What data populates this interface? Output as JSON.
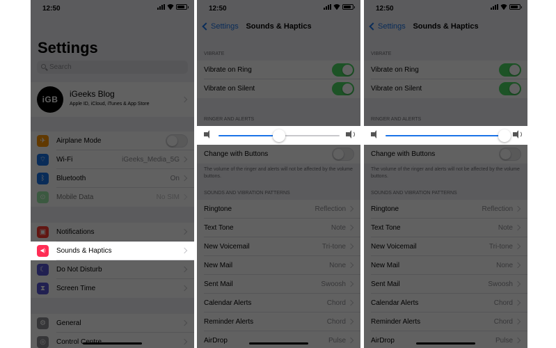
{
  "status": {
    "time": "12:50"
  },
  "screen1": {
    "title": "Settings",
    "search_placeholder": "Search",
    "profile": {
      "name": "iGeeks Blog",
      "subtitle": "Apple ID, iCloud, iTunes & App Store",
      "avatar_text": "iGB"
    },
    "network_rows": [
      {
        "label": "Airplane Mode",
        "value": "",
        "icon": "airplane-icon",
        "glyph": "✈"
      },
      {
        "label": "Wi-Fi",
        "value": "iGeeks_Media_5G",
        "icon": "wifi-icon",
        "glyph": "⌔"
      },
      {
        "label": "Bluetooth",
        "value": "On",
        "icon": "bluetooth-icon",
        "glyph": "ᛒ"
      },
      {
        "label": "Mobile Data",
        "value": "No SIM",
        "icon": "antenna-icon",
        "glyph": "⊙"
      }
    ],
    "notif_rows": [
      {
        "label": "Notifications",
        "icon": "notifications-icon",
        "glyph": "▣"
      },
      {
        "label": "Sounds & Haptics",
        "icon": "speaker-icon",
        "glyph": "◀)"
      },
      {
        "label": "Do Not Disturb",
        "icon": "moon-icon",
        "glyph": "☾"
      },
      {
        "label": "Screen Time",
        "icon": "hourglass-icon",
        "glyph": "⧗"
      }
    ],
    "general_rows": [
      {
        "label": "General",
        "icon": "gear-icon",
        "glyph": "⚙"
      },
      {
        "label": "Control Centre",
        "icon": "control-centre-icon",
        "glyph": "◎"
      }
    ]
  },
  "sounds": {
    "back_label": "Settings",
    "nav_title": "Sounds & Haptics",
    "vibrate_header": "VIBRATE",
    "vibrate_on_ring": "Vibrate on Ring",
    "vibrate_on_silent": "Vibrate on Silent",
    "ringer_header": "RINGER AND ALERTS",
    "change_with_buttons": "Change with Buttons",
    "ringer_note": "The volume of the ringer and alerts will not be affected by the volume buttons.",
    "patterns_header": "SOUNDS AND VIBRATION PATTERNS",
    "patterns": [
      {
        "label": "Ringtone",
        "value": "Reflection"
      },
      {
        "label": "Text Tone",
        "value": "Note"
      },
      {
        "label": "New Voicemail",
        "value": "Tri-tone"
      },
      {
        "label": "New Mail",
        "value": "None"
      },
      {
        "label": "Sent Mail",
        "value": "Swoosh"
      },
      {
        "label": "Calendar Alerts",
        "value": "Chord"
      },
      {
        "label": "Reminder Alerts",
        "value": "Chord"
      },
      {
        "label": "AirDrop",
        "value": "Pulse"
      }
    ]
  },
  "volume": {
    "screen2": 0.5,
    "screen3": 0.98
  },
  "colors": {
    "accent": "#1a73e8",
    "toggle_on": "#4cd964"
  }
}
